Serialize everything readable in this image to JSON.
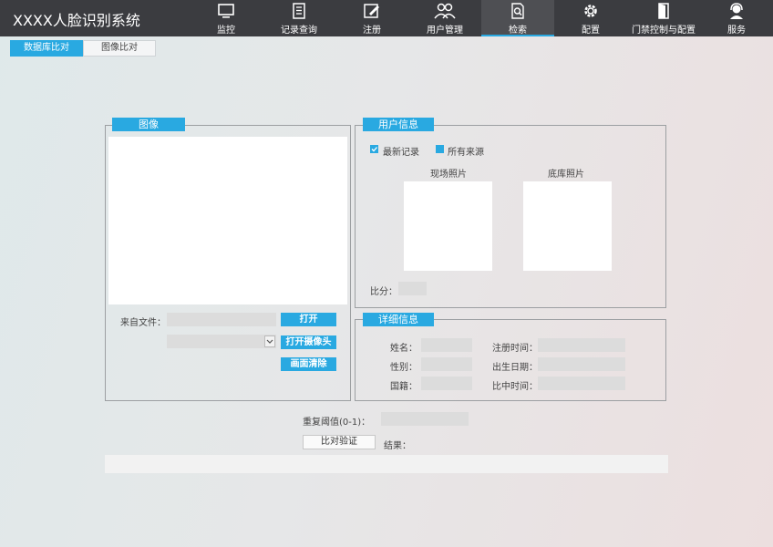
{
  "app": {
    "title": "XXXX人脸识别系统"
  },
  "nav": [
    {
      "label": "监控",
      "icon": "monitor-icon"
    },
    {
      "label": "记录查询",
      "icon": "document-icon"
    },
    {
      "label": "注册",
      "icon": "edit-icon"
    },
    {
      "label": "用户管理",
      "icon": "users-icon"
    },
    {
      "label": "检索",
      "icon": "search-file-icon",
      "active": true
    },
    {
      "label": "配置",
      "icon": "gear-icon"
    },
    {
      "label": "门禁控制与配置",
      "icon": "door-icon"
    },
    {
      "label": "服务",
      "icon": "support-icon"
    }
  ],
  "subtabs": [
    {
      "label": "数据库比对",
      "active": true
    },
    {
      "label": "图像比对",
      "active": false
    }
  ],
  "image_panel": {
    "title": "图像",
    "from_file_label": "来自文件：",
    "open_button": "打开",
    "open_camera_button": "打开摄像头",
    "clear_button": "画面清除"
  },
  "user_info": {
    "title": "用户信息",
    "latest_record": "最新记录",
    "all_sources": "所有来源",
    "scene_photo": "现场照片",
    "db_photo": "底库照片",
    "score_label": "比分："
  },
  "detail_info": {
    "title": "详细信息",
    "name_label": "姓名：",
    "gender_label": "性别：",
    "nationality_label": "国籍：",
    "register_time_label": "注册时间：",
    "birth_date_label": "出生日期：",
    "match_time_label": "比中时间："
  },
  "bottom": {
    "threshold_label": "重复阈值(0-1)：",
    "verify_button": "比对验证",
    "result_label": "结果："
  },
  "colors": {
    "accent": "#29a9e1",
    "topbar": "#3b3c40"
  }
}
